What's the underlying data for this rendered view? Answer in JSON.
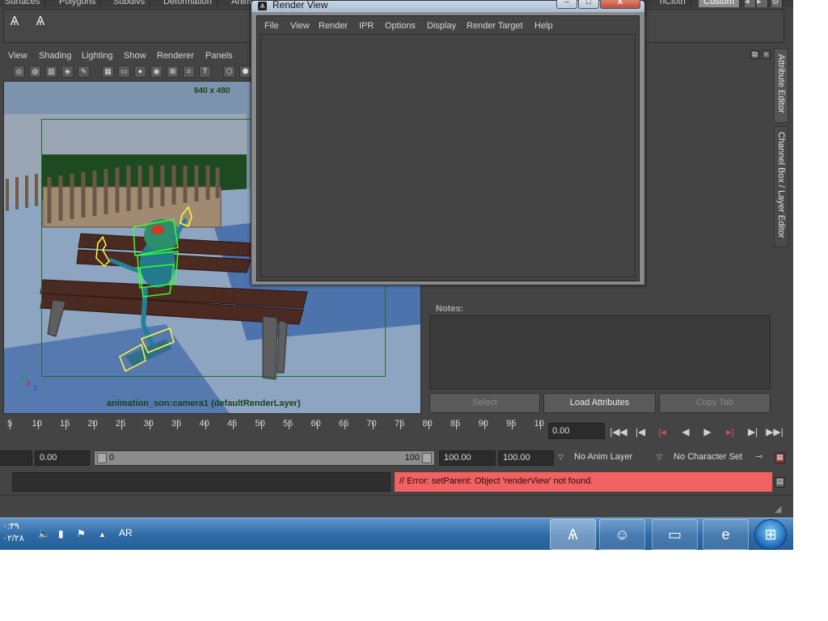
{
  "shelf": {
    "tabs": [
      "Surfaces",
      "Polygons",
      "Subdivs",
      "Deformation",
      "Anim",
      "nCloth",
      "Custom"
    ],
    "active_tab": "Custom"
  },
  "panel_menu": [
    "View",
    "Shading",
    "Lighting",
    "Show",
    "Renderer",
    "Panels"
  ],
  "viewport": {
    "resolution": "640 x 480",
    "camera_label": "animation_son:camera1 (defaultRenderLayer)",
    "axis_y": "y",
    "axis_x": "x",
    "axis_z": "z",
    "colors": {
      "gate": "#1e6b2b",
      "rig_selection": "#ffff3a",
      "rig_controls": "#33ff33"
    }
  },
  "render_view": {
    "title": "Render View",
    "menu": [
      "File",
      "View",
      "Render",
      "IPR",
      "Options",
      "Display",
      "Render Target",
      "Help"
    ],
    "minimize": "–",
    "maximize": "□",
    "close": "X"
  },
  "side_tabs": {
    "attribute_editor": "Attribute Editor",
    "channel_box": "Channel Box / Layer Editor"
  },
  "attribute_editor": {
    "notes_label": "Notes:",
    "buttons": {
      "select": "Select",
      "load_attributes": "Load Attributes",
      "copy_tab": "Copy Tab"
    }
  },
  "time_slider": {
    "ticks": [
      "5",
      "10",
      "15",
      "20",
      "25",
      "30",
      "35",
      "40",
      "45",
      "50",
      "55",
      "60",
      "65",
      "70",
      "75",
      "80",
      "85",
      "90",
      "95",
      "10"
    ],
    "current_time": "0.00"
  },
  "playback_icons": [
    "go-to-start-icon",
    "step-back-key-icon",
    "step-back-frame-icon",
    "play-backward-icon",
    "play-forward-icon",
    "step-forward-frame-icon",
    "step-forward-key-icon",
    "go-to-end-icon"
  ],
  "range": {
    "start_time": "0.00",
    "playback_start": "0",
    "playback_end": "100",
    "end_time": "100.00",
    "animation_end": "100.00",
    "anim_layer": "No Anim Layer",
    "character_set": "No Character Set"
  },
  "command_line": {
    "input": "",
    "error": "// Error: setParent: Object 'renderView' not found.",
    "error_color": "#f26262"
  },
  "taskbar": {
    "time": "٠:٣٩",
    "date": "٠٢/٢٨",
    "language": "AR"
  }
}
